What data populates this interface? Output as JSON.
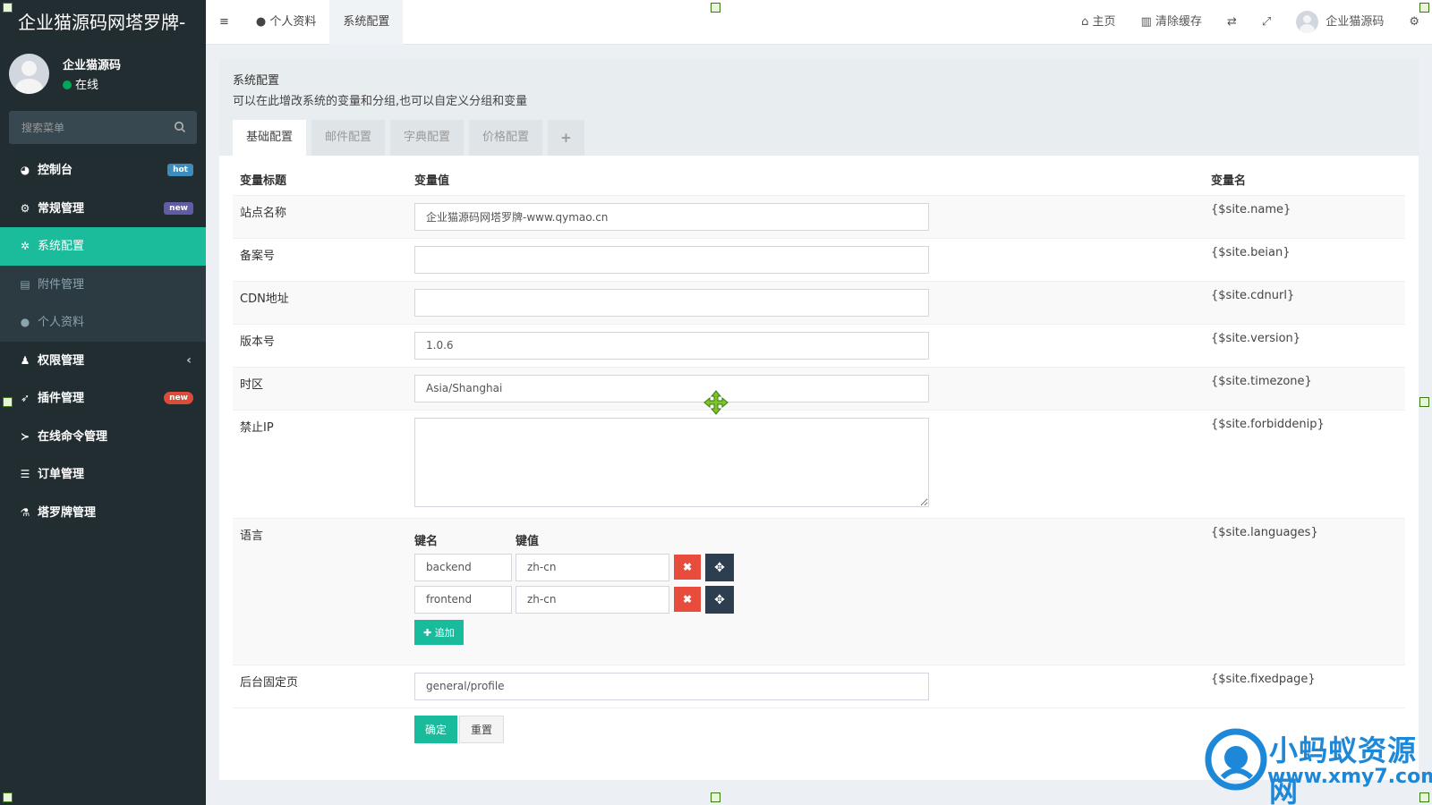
{
  "brand": "企业猫源码网塔罗牌-",
  "user": {
    "name": "企业猫源码",
    "status": "在线"
  },
  "search": {
    "placeholder": "搜索菜单"
  },
  "menu": [
    {
      "label": "控制台",
      "icon": "dashboard-icon",
      "badge": "hot"
    },
    {
      "label": "常规管理",
      "icon": "cogs-icon",
      "badge": "new"
    },
    {
      "label": "系统配置",
      "icon": "gear-icon"
    },
    {
      "label": "附件管理",
      "icon": "file-icon"
    },
    {
      "label": "个人资料",
      "icon": "user-icon"
    },
    {
      "label": "权限管理",
      "icon": "group-icon"
    },
    {
      "label": "插件管理",
      "icon": "rocket-icon",
      "badge": "new"
    },
    {
      "label": "在线命令管理",
      "icon": "terminal-icon"
    },
    {
      "label": "订单管理",
      "icon": "list-icon"
    },
    {
      "label": "塔罗牌管理",
      "icon": "flask-icon"
    }
  ],
  "topnav": {
    "tabs": [
      "个人资料",
      "系统配置"
    ],
    "home": "主页",
    "clear_cache": "清除缓存",
    "username": "企业猫源码"
  },
  "panel": {
    "title": "系统配置",
    "desc": "可以在此增改系统的变量和分组,也可以自定义分组和变量",
    "tabs": [
      "基础配置",
      "邮件配置",
      "字典配置",
      "价格配置",
      "+"
    ]
  },
  "table": {
    "headers": [
      "变量标题",
      "变量值",
      "变量名"
    ],
    "rows": [
      {
        "title": "站点名称",
        "value": "企业猫源码网塔罗牌-www.qymao.cn",
        "var": "{$site.name}"
      },
      {
        "title": "备案号",
        "value": "",
        "var": "{$site.beian}"
      },
      {
        "title": "CDN地址",
        "value": "",
        "var": "{$site.cdnurl}"
      },
      {
        "title": "版本号",
        "value": "1.0.6",
        "var": "{$site.version}"
      },
      {
        "title": "时区",
        "value": "Asia/Shanghai",
        "var": "{$site.timezone}"
      },
      {
        "title": "禁止IP",
        "value": "",
        "var": "{$site.forbiddenip}"
      },
      {
        "title": "语言",
        "var": "{$site.languages}"
      },
      {
        "title": "后台固定页",
        "value": "general/profile",
        "var": "{$site.fixedpage}"
      }
    ],
    "languages": {
      "key_header": "键名",
      "value_header": "键值",
      "items": [
        {
          "key": "backend",
          "value": "zh-cn"
        },
        {
          "key": "frontend",
          "value": "zh-cn"
        }
      ],
      "add_label": "追加"
    }
  },
  "buttons": {
    "ok": "确定",
    "reset": "重置"
  },
  "watermark": {
    "line1": "小蚂蚁资源网",
    "line2": "www.xmy7.com"
  },
  "colors": {
    "sidebar": "#222d32",
    "accent": "#18bc9c",
    "danger": "#e74c3c",
    "dark": "#2c3e50"
  }
}
